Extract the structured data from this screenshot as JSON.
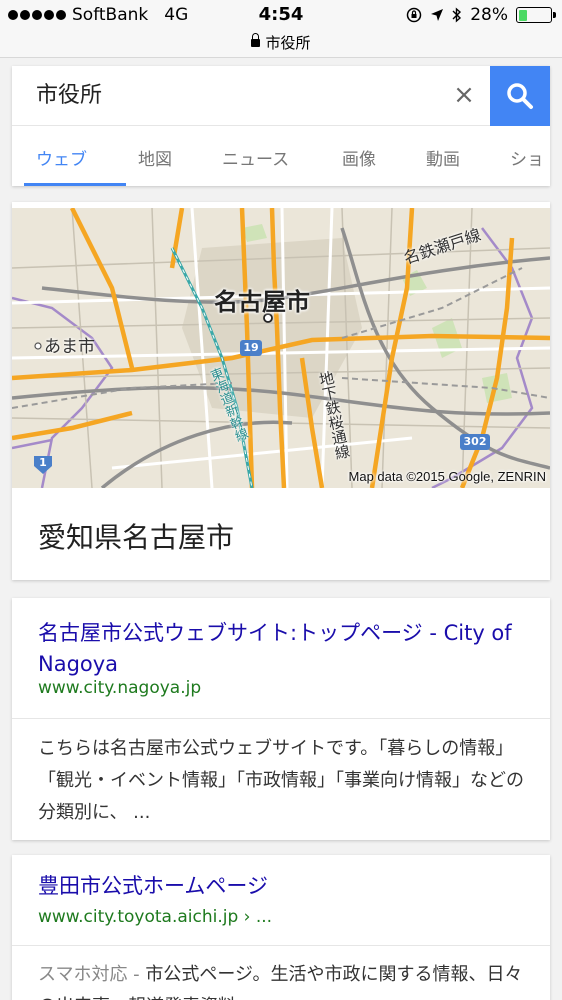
{
  "status": {
    "carrier": "SoftBank",
    "network": "4G",
    "time": "4:54",
    "battery": "28%",
    "battery_level": 0.28,
    "url": "市役所"
  },
  "search": {
    "query": "市役所",
    "clear_label": "×",
    "tabs": [
      "ウェブ",
      "地図",
      "ニュース",
      "画像",
      "動画",
      "ショ"
    ]
  },
  "map": {
    "labels": {
      "city": "名古屋市",
      "ama": "あま市",
      "meitetsu": "名鉄瀬戸線",
      "subway": "地下鉄桜通線",
      "shinkansen": "東海道新幹線",
      "route19": "19",
      "route302": "302",
      "route1": "1"
    },
    "attribution": "Map data ©2015 Google, ZENRIN",
    "title": "愛知県名古屋市"
  },
  "results": [
    {
      "title": "名古屋市公式ウェブサイト:トップページ - City of Nagoya",
      "url": "www.city.nagoya.jp",
      "snippet": "こちらは名古屋市公式ウェブサイトです。「暮らしの情報」「観光・イベント情報」「市政情報」「事業向け情報」などの分類別に、 ..."
    },
    {
      "title": "豊田市公式ホームページ",
      "url": "www.city.toyota.aichi.jp › ...",
      "snippet_prefix": "スマホ対応 - ",
      "snippet": "市公式ページ。生活や市政に関する情報、日々の出来事、報道発表資料"
    }
  ]
}
